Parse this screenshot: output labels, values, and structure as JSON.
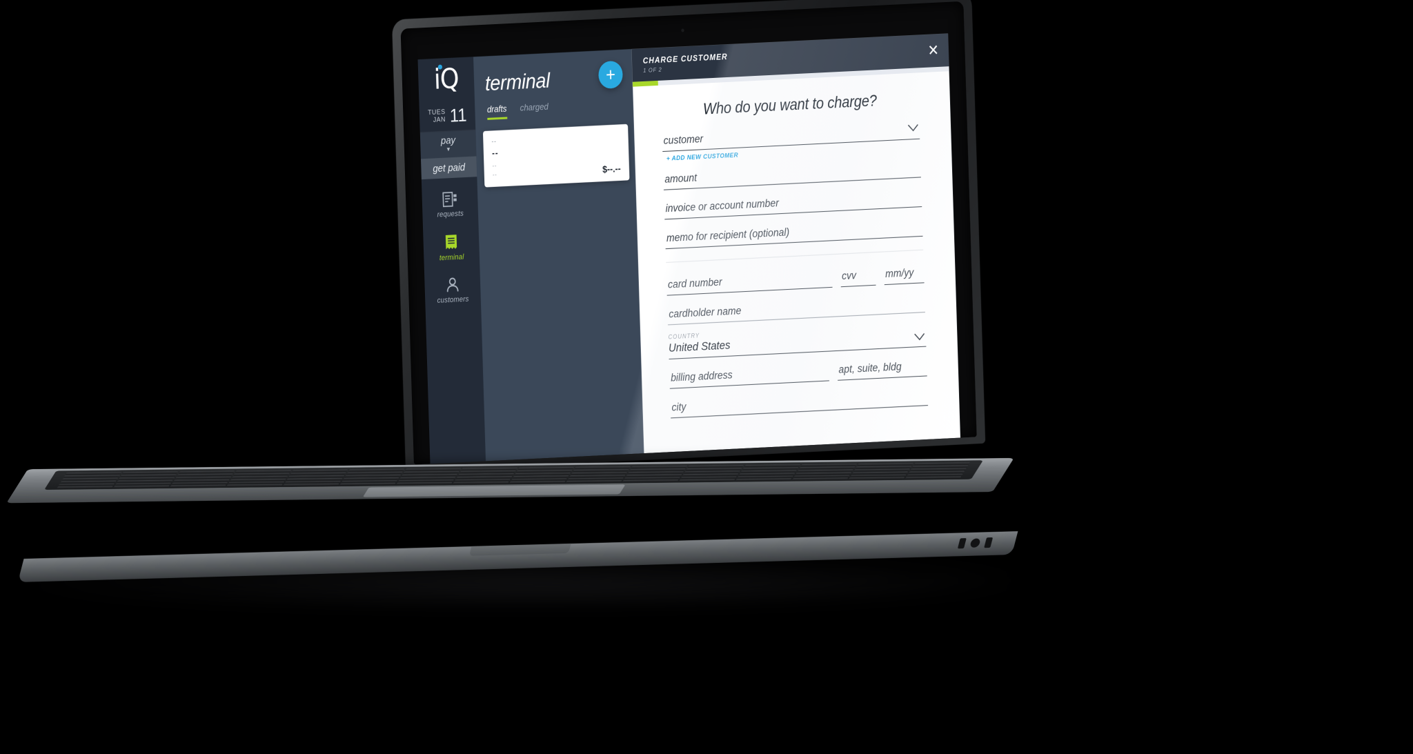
{
  "rail": {
    "logo_text": "iQ",
    "date": {
      "dow": "TUES",
      "mon": "JAN",
      "day": "11"
    },
    "pay_label": "pay",
    "pay_chevron": "chevron-down",
    "get_paid_label": "get paid",
    "nav": [
      {
        "icon": "requests-document-icon",
        "label": "requests",
        "active": false
      },
      {
        "icon": "terminal-receipt-icon",
        "label": "terminal",
        "active": true
      },
      {
        "icon": "customers-person-icon",
        "label": "customers",
        "active": false
      }
    ]
  },
  "middle": {
    "title": "terminal",
    "tabs": [
      {
        "label": "drafts",
        "active": true
      },
      {
        "label": "charged",
        "active": false
      }
    ],
    "add_button": "+",
    "draft_card": {
      "line1": "--",
      "line2": "--",
      "line3": "--",
      "line4": "--",
      "amount": "$--.--"
    }
  },
  "drawer": {
    "title": "CHARGE CUSTOMER",
    "step": "1 OF 2",
    "close_icon": "close-x-icon",
    "progress_percent": 8,
    "heading": "Who do you want to charge?",
    "fields": {
      "customer": {
        "placeholder": "customer",
        "value": ""
      },
      "add_new_customer": "+ ADD NEW CUSTOMER",
      "amount": {
        "placeholder": "amount",
        "value": ""
      },
      "invoice": {
        "placeholder": "invoice or account number",
        "value": ""
      },
      "memo": {
        "placeholder": "memo for recipient (optional)",
        "value": ""
      },
      "card_number": {
        "placeholder": "card number",
        "value": ""
      },
      "cvv": {
        "placeholder": "cvv",
        "value": ""
      },
      "expiry": {
        "placeholder": "mm/yy",
        "value": ""
      },
      "cardholder": {
        "placeholder": "cardholder name",
        "value": ""
      },
      "country": {
        "label": "COUNTRY",
        "value": "United States"
      },
      "billing_address": {
        "placeholder": "billing address",
        "value": ""
      },
      "apt": {
        "placeholder": "apt, suite, bldg",
        "value": ""
      },
      "city": {
        "placeholder": "city",
        "value": ""
      }
    }
  },
  "colors": {
    "rail_bg": "#232b38",
    "mid_bg": "#3b4859",
    "drawer_header_bg": "#2b3442",
    "accent_green": "#a8d82a",
    "accent_blue": "#29a9e0",
    "link_blue": "#2ba6e0"
  }
}
